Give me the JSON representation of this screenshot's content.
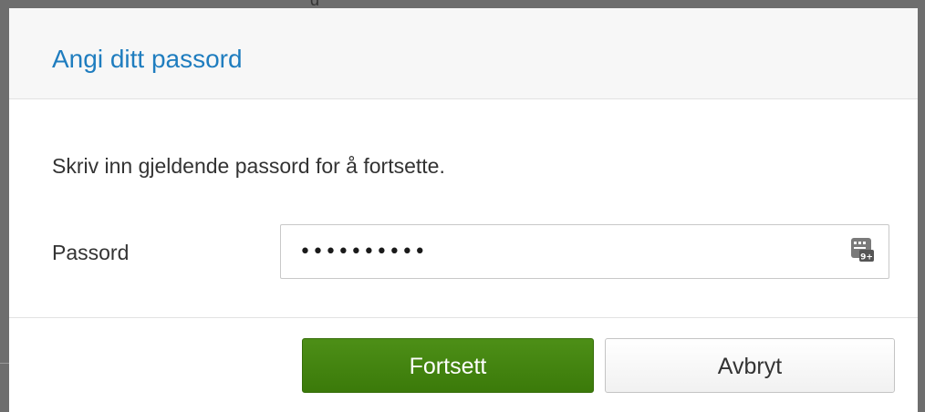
{
  "backdrop": {
    "glyph": "g"
  },
  "dialog": {
    "title": "Angi ditt passord",
    "instructions": "Skriv inn gjeldende passord for å fortsette.",
    "password_label": "Passord",
    "password_value": "••••••••••",
    "keypad_icon": "virtual-keypad-icon",
    "keypad_badge": "9+",
    "continue_label": "Fortsett",
    "cancel_label": "Avbryt"
  },
  "colors": {
    "title": "#1f7dbf",
    "primary_button": "#3b7a0a",
    "header_bg": "#f7f7f7"
  }
}
